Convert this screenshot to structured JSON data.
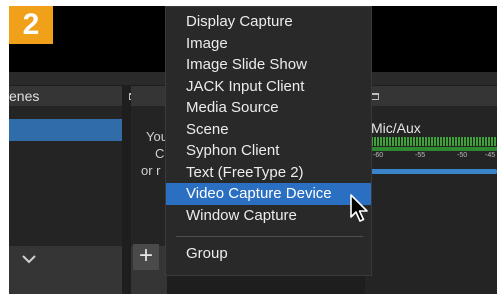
{
  "badge": {
    "number": "2"
  },
  "scenes_panel": {
    "title": "enes"
  },
  "sources_panel": {
    "hint_lines": [
      "You",
      "C",
      "or r"
    ],
    "add_label": "+"
  },
  "mixer": {
    "channel_name": "Mic/Aux",
    "ticks": [
      "-60",
      "-55",
      "-50",
      "-45"
    ],
    "volume_fraction": 1.0
  },
  "context_menu": {
    "items": [
      "Display Capture",
      "Image",
      "Image Slide Show",
      "JACK Input Client",
      "Media Source",
      "Scene",
      "Syphon Client",
      "Text (FreeType 2)",
      "Video Capture Device",
      "Window Capture",
      "Group"
    ],
    "highlighted": "Video Capture Device"
  },
  "colors": {
    "badge": "#f0a019",
    "highlight": "#2b6fc3",
    "meter": "#3fa33a",
    "volume": "#3a85c9"
  },
  "icons": [
    "float-window-icon",
    "chevron-down-icon",
    "plus-icon",
    "mouse-pointer-icon"
  ]
}
